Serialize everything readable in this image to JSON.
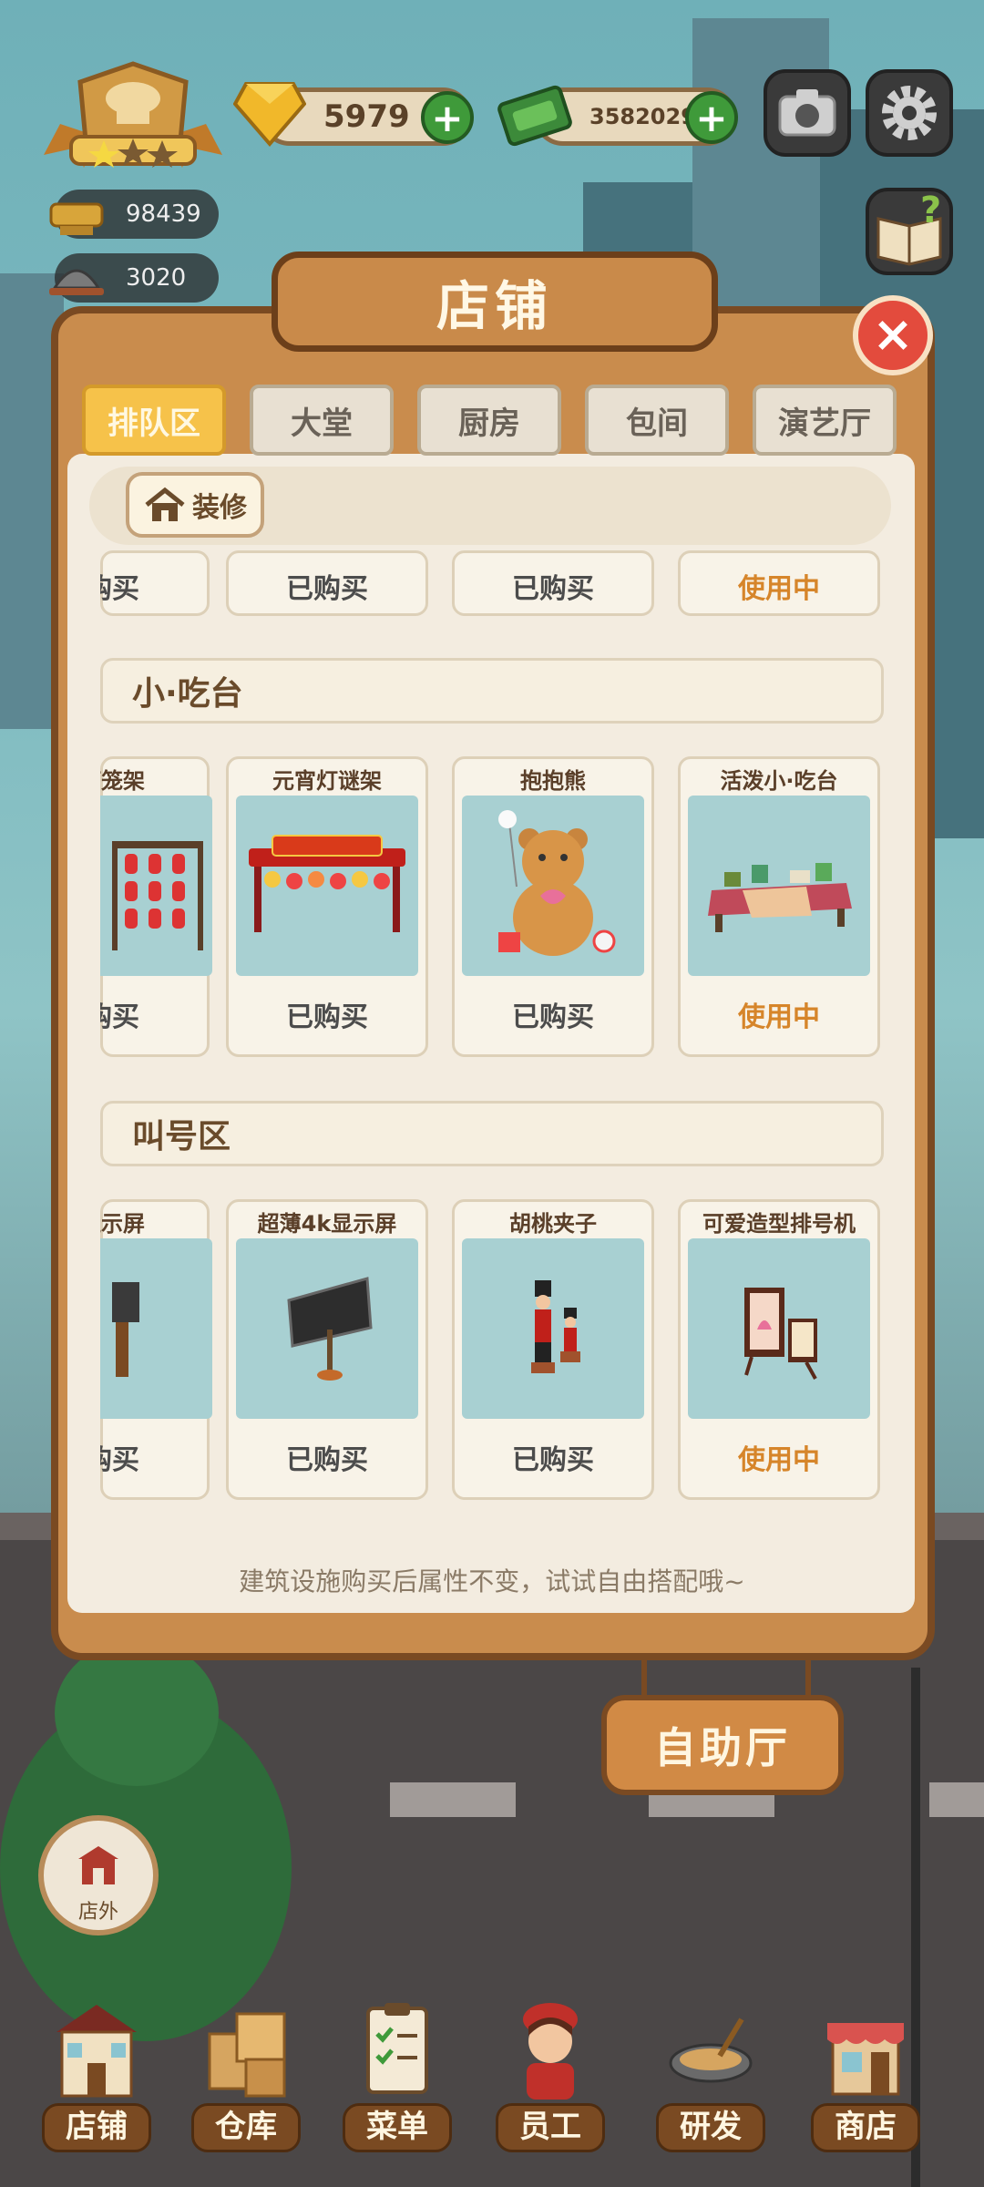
{
  "top_bar": {
    "gems": "5979",
    "cash": "35820290",
    "stat_1": "98439",
    "stat_2": "3020"
  },
  "panel": {
    "title": "店铺",
    "close": "×",
    "tabs": [
      "排队区",
      "大堂",
      "厨房",
      "包间",
      "演艺厅"
    ],
    "active_tab": 0,
    "decorate_label": "装修",
    "footer_note": "建筑设施购买后属性不变，试试自由搭配哦~"
  },
  "top_row": [
    {
      "status": "购买",
      "in_use": false,
      "partial": true
    },
    {
      "status": "已购买",
      "in_use": false
    },
    {
      "status": "已购买",
      "in_use": false
    },
    {
      "status": "使用中",
      "in_use": true
    }
  ],
  "sections": [
    {
      "title": "小·吃台",
      "items": [
        {
          "name": "灯笼架",
          "status": "购买",
          "in_use": false,
          "partial": true,
          "icon": "lantern-rack"
        },
        {
          "name": "元宵灯谜架",
          "status": "已购买",
          "in_use": false,
          "icon": "lantern-riddle-arch"
        },
        {
          "name": "抱抱熊",
          "status": "已购买",
          "in_use": false,
          "icon": "teddy-bear"
        },
        {
          "name": "活泼小·吃台",
          "status": "使用中",
          "in_use": true,
          "icon": "snack-table"
        }
      ]
    },
    {
      "title": "叫号区",
      "items": [
        {
          "name": "显示屏",
          "status": "购买",
          "in_use": false,
          "partial": true,
          "icon": "display-screen"
        },
        {
          "name": "超薄4k显示屏",
          "status": "已购买",
          "in_use": false,
          "icon": "thin-4k-display"
        },
        {
          "name": "胡桃夹子",
          "status": "已购买",
          "in_use": false,
          "icon": "nutcracker"
        },
        {
          "name": "可爱造型排号机",
          "status": "使用中",
          "in_use": true,
          "icon": "queue-machine"
        }
      ]
    }
  ],
  "hanging_sign": "自助厅",
  "outside_button": "店外",
  "bottom_nav": [
    "店铺",
    "仓库",
    "菜单",
    "员工",
    "研发",
    "商店"
  ],
  "colors": {
    "tab_active": "#f6c24a",
    "in_use_text": "#d6852a",
    "close_red": "#e34b3d",
    "plus_green": "#3f9a3a"
  }
}
